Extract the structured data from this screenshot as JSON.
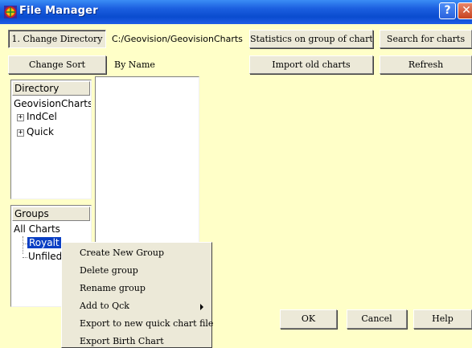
{
  "window": {
    "title": "File Manager"
  },
  "toolbar": {
    "change_directory": "1. Change Directory",
    "current_path": "C:/Geovision/GeovisionCharts",
    "statistics": "Statistics on group of charts",
    "search": "Search for charts",
    "change_sort": "Change Sort",
    "sort_mode": "By Name",
    "import_old": "Import old charts",
    "refresh": "Refresh"
  },
  "directory": {
    "header": "Directory",
    "root": "GeovisionCharts",
    "children": [
      "IndCel",
      "Quick"
    ]
  },
  "groups": {
    "header": "Groups",
    "root": "All Charts",
    "children": [
      "Royalt",
      "Unfiled"
    ],
    "selected": "Royalt"
  },
  "context_menu": {
    "items": [
      "Create New Group",
      "Delete group",
      "Rename group",
      "Add to Qck",
      "Export to new quick chart file",
      "Export Birth Chart"
    ]
  },
  "footer": {
    "ok": "OK",
    "cancel": "Cancel",
    "help": "Help"
  },
  "icons": {
    "app": "chart-wheel-icon",
    "help": "question-icon",
    "close": "close-x-icon",
    "submenu": "triangle-right-icon"
  },
  "colors": {
    "background": "#ffffc8",
    "titlebar": "#0a4ccf",
    "selection": "#0a3fc4",
    "button_face": "#ece9d8"
  }
}
